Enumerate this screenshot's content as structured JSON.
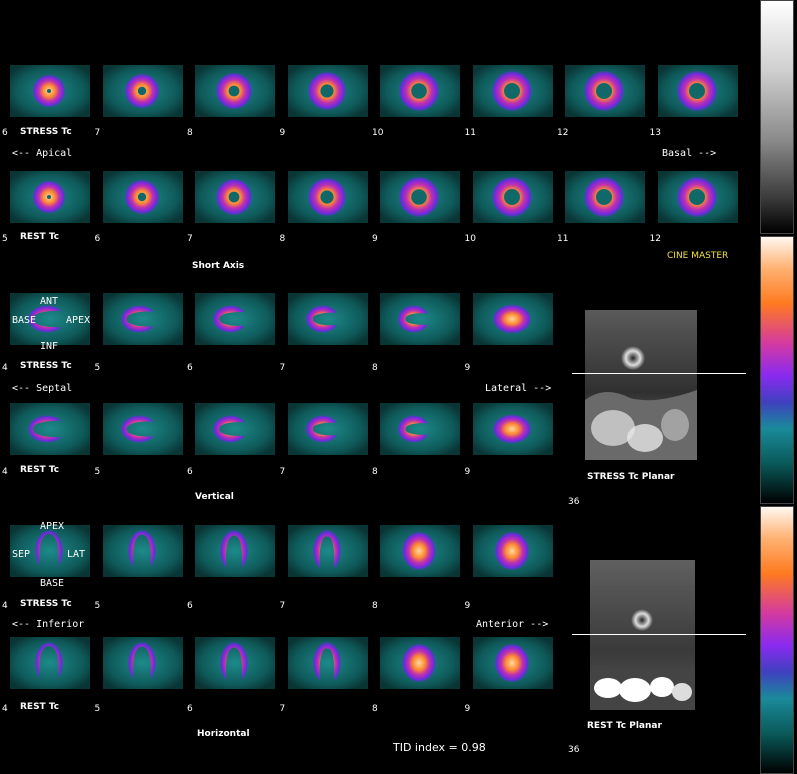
{
  "short_axis": {
    "stress": {
      "label": "STRESS Tc",
      "slices": [
        "6",
        "7",
        "8",
        "9",
        "10",
        "11",
        "12",
        "13"
      ]
    },
    "rest": {
      "label": "REST Tc",
      "slices": [
        "5",
        "6",
        "7",
        "8",
        "9",
        "10",
        "11",
        "12"
      ]
    },
    "left_dir": "<-- Apical",
    "right_dir": "Basal -->",
    "title": "Short Axis"
  },
  "vertical": {
    "stress": {
      "label": "STRESS Tc",
      "slices": [
        "4",
        "5",
        "6",
        "7",
        "8",
        "9"
      ]
    },
    "rest": {
      "label": "REST Tc",
      "slices": [
        "4",
        "5",
        "6",
        "7",
        "8",
        "9"
      ]
    },
    "left_dir": "<-- Septal",
    "right_dir": "Lateral -->",
    "title": "Vertical",
    "orient": {
      "top": "ANT",
      "left": "BASE",
      "right": "APEX",
      "bottom": "INF"
    }
  },
  "horizontal": {
    "stress": {
      "label": "STRESS Tc",
      "slices": [
        "4",
        "5",
        "6",
        "7",
        "8",
        "9"
      ]
    },
    "rest": {
      "label": "REST Tc",
      "slices": [
        "4",
        "5",
        "6",
        "7",
        "8",
        "9"
      ]
    },
    "left_dir": "<-- Inferior",
    "right_dir": "Anterior -->",
    "title": "Horizontal",
    "orient": {
      "top": "APEX",
      "left": "SEP",
      "right": "LAT",
      "bottom": "BASE"
    }
  },
  "cine_master": "CINE MASTER",
  "planar": {
    "stress_label": "STRESS Tc Planar",
    "rest_label": "REST Tc Planar",
    "frame_stress": "36",
    "frame_rest": "36"
  },
  "tid": "TID index = 0.98",
  "colors": {
    "background": "#000000",
    "cine": "#f0e040"
  },
  "icons": [
    "grayscale-colorbar",
    "thermal-colorbar",
    "thermal-colorbar-bottom"
  ]
}
